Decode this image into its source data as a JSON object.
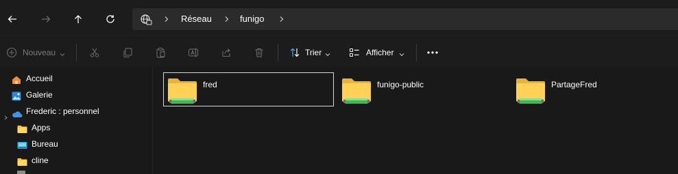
{
  "navigation": {
    "back_icon": "arrow-left-icon",
    "forward_icon": "arrow-right-icon",
    "up_icon": "arrow-up-icon",
    "refresh_icon": "refresh-icon"
  },
  "address_bar": {
    "root_icon": "network-globe-icon",
    "breadcrumbs": [
      "Réseau",
      "funigo"
    ]
  },
  "toolbar": {
    "new_label": "Nouveau",
    "sort_label": "Trier",
    "view_label": "Afficher",
    "more_icon": "more-horizontal-icon"
  },
  "sidebar": {
    "items": [
      {
        "label": "Accueil",
        "icon": "home-icon"
      },
      {
        "label": "Galerie",
        "icon": "gallery-icon"
      },
      {
        "label": "Frederic : personnel",
        "icon": "onedrive-cloud-icon"
      },
      {
        "label": "Apps",
        "icon": "folder-icon"
      },
      {
        "label": "Bureau",
        "icon": "desktop-icon"
      },
      {
        "label": "cline",
        "icon": "folder-icon"
      }
    ]
  },
  "content": {
    "items": [
      {
        "name": "fred",
        "icon": "shared-folder-icon",
        "selected": true
      },
      {
        "name": "funigo-public",
        "icon": "shared-folder-icon",
        "selected": false
      },
      {
        "name": "PartageFred",
        "icon": "shared-folder-icon",
        "selected": false
      }
    ]
  },
  "colors": {
    "background": "#191919",
    "address_bg": "#2b2b2b",
    "folder_yellow": "#f4c34a",
    "share_green": "#3fb950"
  }
}
